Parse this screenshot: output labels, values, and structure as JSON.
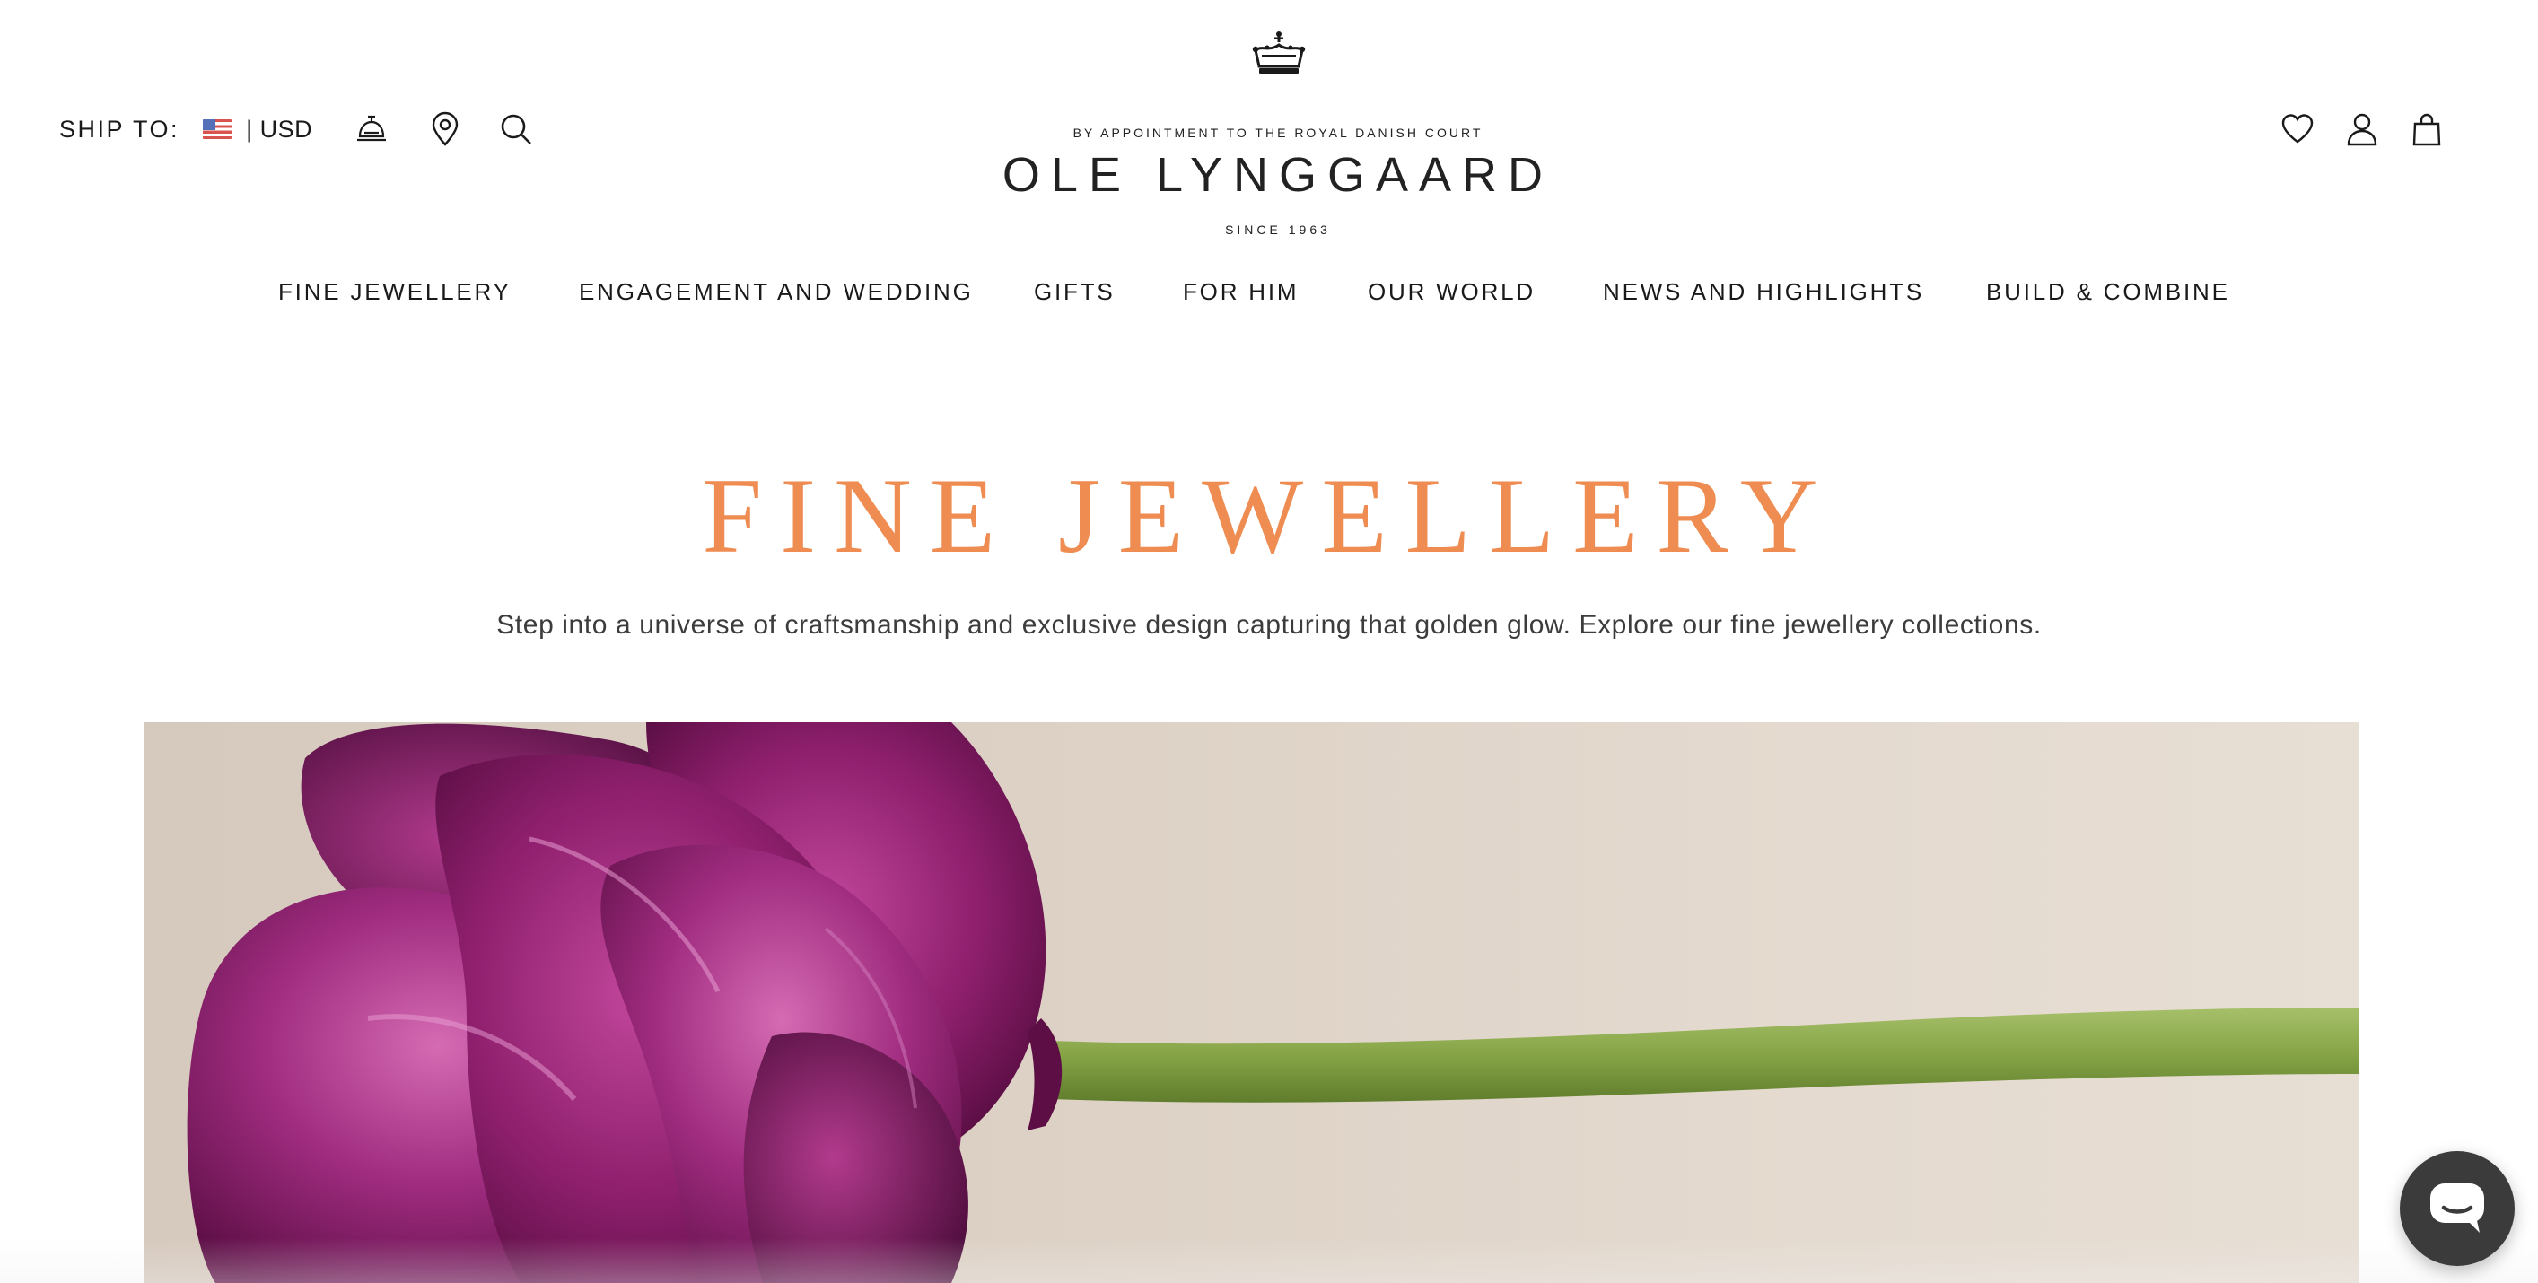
{
  "header": {
    "ship_to_label": "SHIP TO:",
    "currency": "| USD",
    "flag": "us-flag-icon",
    "left_icons": [
      "concierge-bell-icon",
      "store-locator-icon",
      "search-icon"
    ],
    "right_icons": [
      "wishlist-heart-icon",
      "account-icon",
      "shopping-bag-icon"
    ]
  },
  "logo": {
    "tagline": "BY APPOINTMENT TO THE ROYAL DANISH COURT",
    "name": "OLE LYNGGAARD",
    "since": "SINCE 1963",
    "emblem": "crown-icon"
  },
  "nav": {
    "items": [
      "FINE JEWELLERY",
      "ENGAGEMENT AND WEDDING",
      "GIFTS",
      "FOR HIM",
      "OUR WORLD",
      "NEWS AND HIGHLIGHTS",
      "BUILD & COMBINE"
    ]
  },
  "hero": {
    "title": "FINE JEWELLERY",
    "subtitle": "Step into a universe of craftsmanship and exclusive design capturing that golden glow. Explore our fine jewellery collections.",
    "image": "purple-tulip-photo"
  },
  "chat": {
    "icon": "chat-bubble-icon"
  },
  "colors": {
    "title_accent": "#ee8c52",
    "chat_button": "#3b3b3b",
    "tulip": "#8a1f6a",
    "stem": "#8fae4f"
  }
}
